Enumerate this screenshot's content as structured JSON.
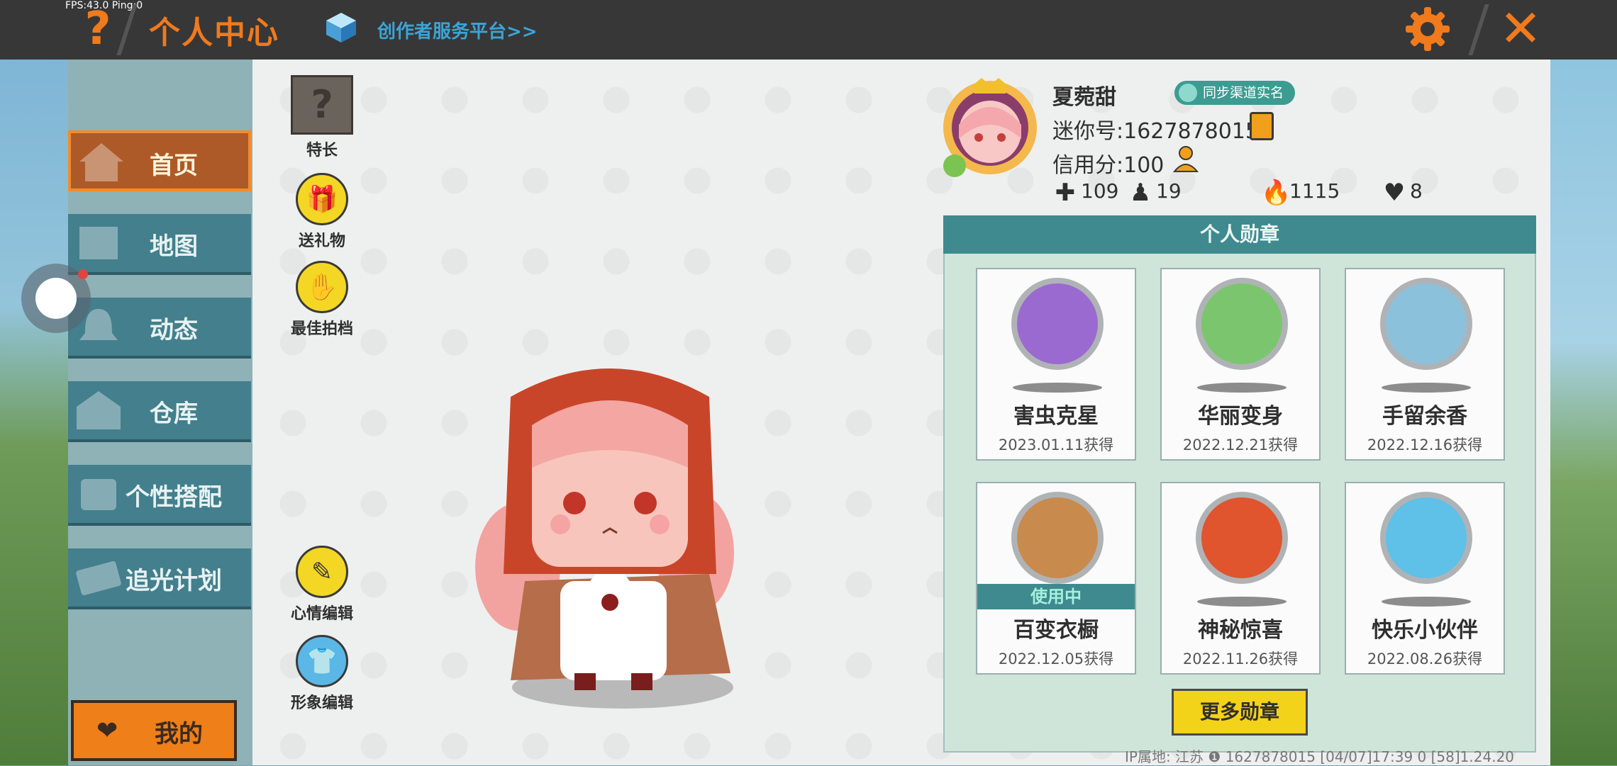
{
  "debug": {
    "fps_text": "FPS:43.0  Ping:0"
  },
  "header": {
    "title": "个人中心",
    "creator_link": "创作者服务平台>>",
    "help_glyph": "?",
    "close_glyph": "✕"
  },
  "sidebar": {
    "items": [
      {
        "label": "首页",
        "active": true
      },
      {
        "label": "地图",
        "active": false
      },
      {
        "label": "动态",
        "active": false
      },
      {
        "label": "仓库",
        "active": false
      },
      {
        "label": "个性搭配",
        "active": false
      },
      {
        "label": "追光计划",
        "active": false
      }
    ],
    "mine_label": "我的"
  },
  "tools": {
    "skill_label": "特长",
    "gift_label": "送礼物",
    "best_photo_label": "最佳拍档",
    "mood_edit_label": "心情编辑",
    "look_edit_label": "形象编辑"
  },
  "profile": {
    "name": "夏菀甜",
    "realname_badge": "同步渠道实名",
    "mini_id": "迷你号:1627878015",
    "credit": "信用分:100",
    "stats": {
      "add": "109",
      "fans": "19",
      "heat": "1115",
      "likes": "8"
    }
  },
  "medals": {
    "header": "个人勋章",
    "items": [
      {
        "name": "害虫克星",
        "date": "2023.01.11获得",
        "in_use": false,
        "color": "#9b6ad1"
      },
      {
        "name": "华丽变身",
        "date": "2022.12.21获得",
        "in_use": false,
        "color": "#7cc56f"
      },
      {
        "name": "手留余香",
        "date": "2022.12.16获得",
        "in_use": false,
        "color": "#8cc1dc"
      },
      {
        "name": "百变衣橱",
        "date": "2022.12.05获得",
        "in_use": true,
        "in_use_label": "使用中",
        "color": "#c98a4e"
      },
      {
        "name": "神秘惊喜",
        "date": "2022.11.26获得",
        "in_use": false,
        "color": "#e0542e"
      },
      {
        "name": "快乐小伙伴",
        "date": "2022.08.26获得",
        "in_use": false,
        "color": "#5fc0e8"
      }
    ],
    "more_button": "更多勋章"
  },
  "footer": {
    "text": "IP属地: 江苏 ❶  1627878015   [04/07]17:39 0   [58]1.24.20"
  },
  "colors": {
    "accent_orange": "#f07a1c",
    "teal": "#3f8a8f",
    "active_nav": "#ad5a28"
  }
}
